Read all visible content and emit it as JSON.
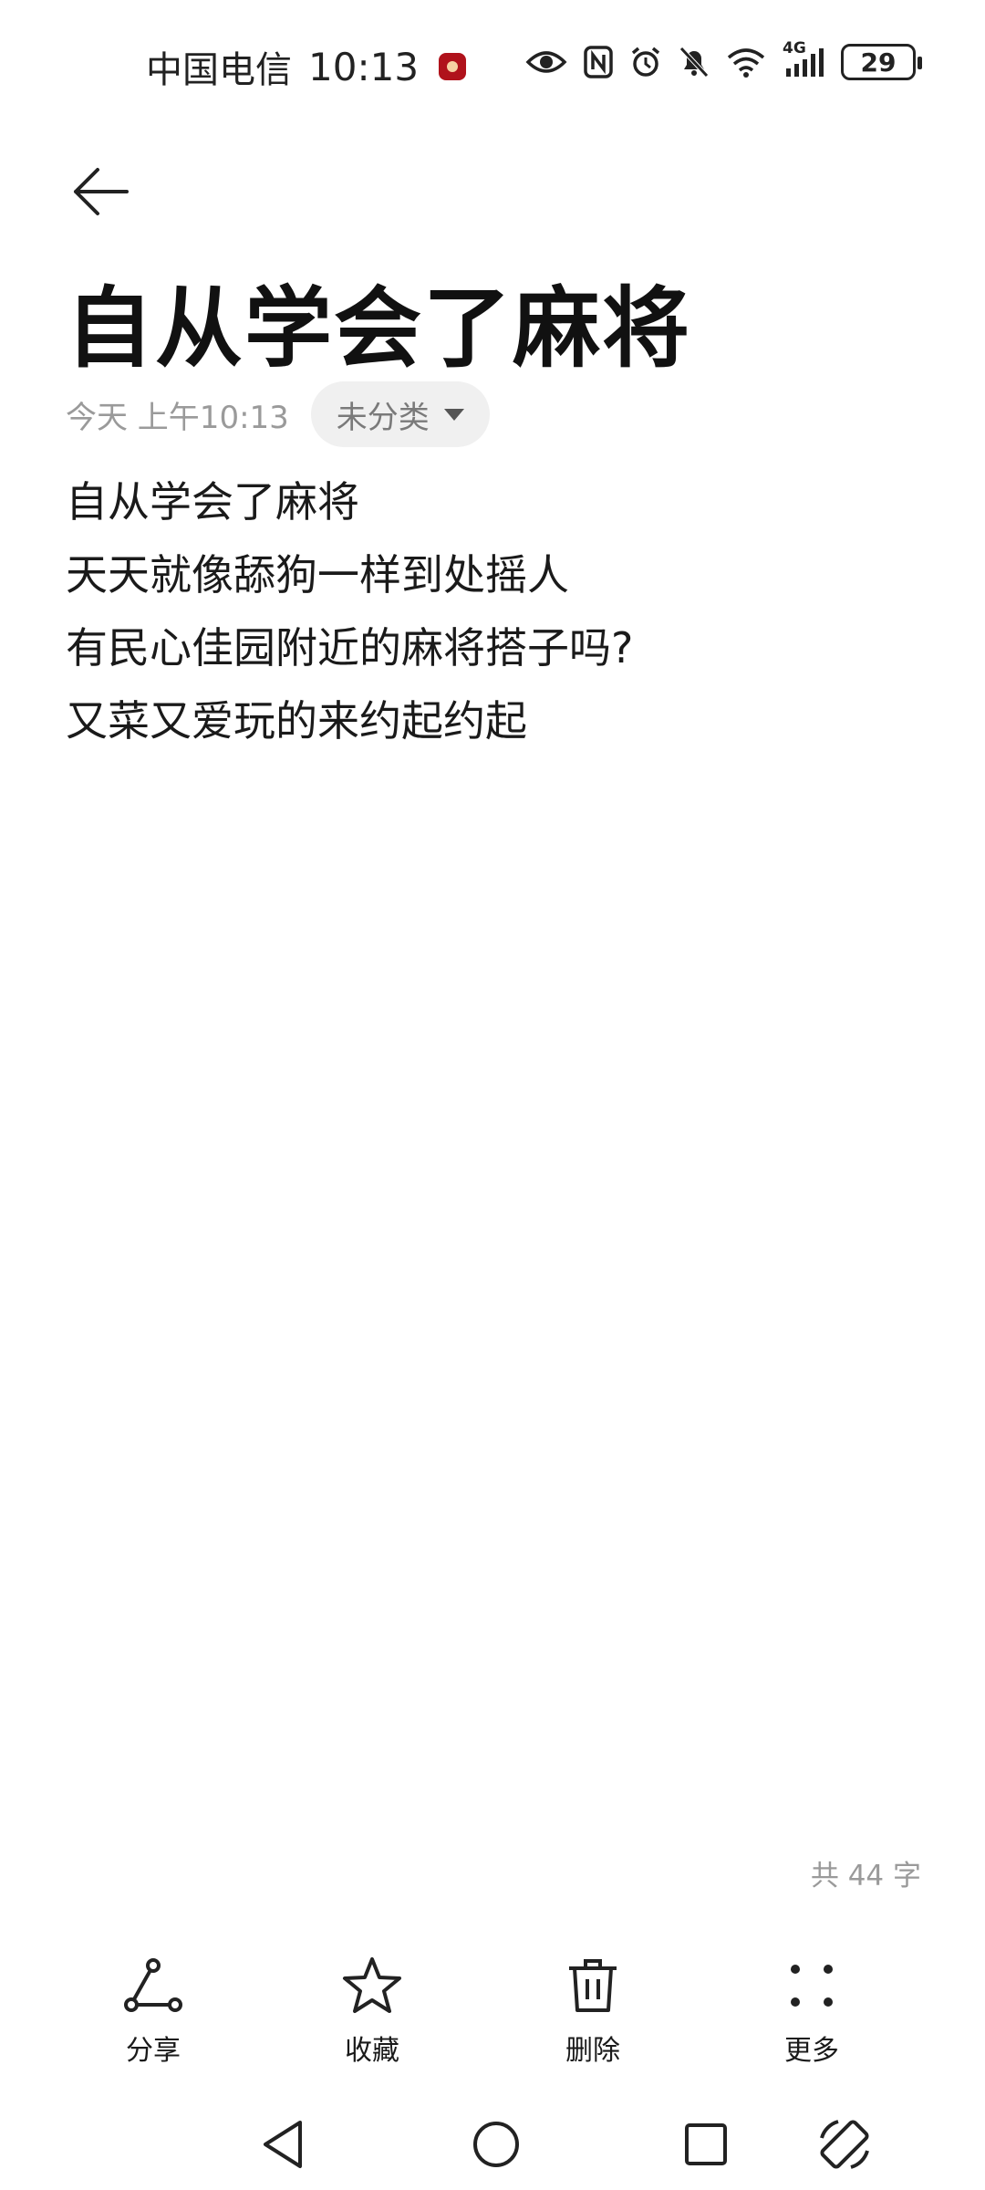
{
  "status_bar": {
    "carrier": "中国电信",
    "time": "10:13",
    "network": "4G",
    "battery": "29",
    "icons": [
      "eye-icon",
      "nfc-icon",
      "alarm-icon",
      "mute-icon",
      "wifi-icon",
      "signal-icon",
      "battery-icon"
    ]
  },
  "note": {
    "title": "自从学会了麻将",
    "date": "今天 上午10:13",
    "category": "未分类",
    "lines": [
      "自从学会了麻将",
      "天天就像舔狗一样到处摇人",
      "有民心佳园附近的麻将搭子吗?",
      "又菜又爱玩的来约起约起"
    ],
    "word_count": "共 44 字"
  },
  "toolbar": {
    "items": [
      {
        "label": "分享",
        "icon": "share-icon"
      },
      {
        "label": "收藏",
        "icon": "star-icon"
      },
      {
        "label": "删除",
        "icon": "trash-icon"
      },
      {
        "label": "更多",
        "icon": "more-icon"
      }
    ]
  },
  "nav": {
    "icons": [
      "back-triangle-icon",
      "home-circle-icon",
      "recents-square-icon",
      "rotate-icon"
    ]
  }
}
